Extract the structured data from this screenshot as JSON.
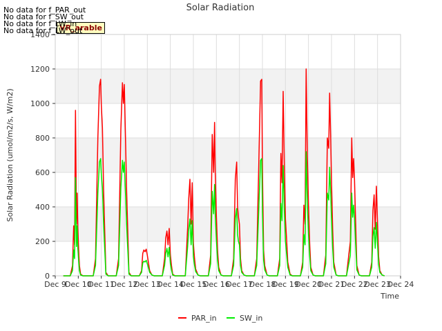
{
  "no_data_messages": [
    "No data for f_PAR_out",
    "No data for f_SW_out",
    "No data for f_LW_in",
    "No data for f_LW_out"
  ],
  "badge_label": "VR_arable",
  "chart_data": {
    "type": "line",
    "title": "Solar Radiation",
    "xlabel": "Time",
    "ylabel": "Solar Radiation (umol/m2/s, W/m2)",
    "ylim": [
      0,
      1400
    ],
    "yticks": [
      0,
      200,
      400,
      600,
      800,
      1000,
      1200,
      1400
    ],
    "xlim": [
      9,
      24
    ],
    "xticks": [
      9,
      10,
      11,
      12,
      13,
      14,
      15,
      16,
      17,
      18,
      19,
      20,
      21,
      22,
      23,
      24
    ],
    "xtick_labels": [
      "Dec 9",
      "Dec 10",
      "Dec 11",
      "Dec 12",
      "Dec 13",
      "Dec 14",
      "Dec 15",
      "Dec 16",
      "Dec 17",
      "Dec 18",
      "Dec 19",
      "Dec 20",
      "Dec 21",
      "Dec 22",
      "Dec 23",
      "Dec 24"
    ],
    "grid": true,
    "legend_position": "bottom-center",
    "series": [
      {
        "name": "PAR_in",
        "color": "#ff0000",
        "x": [
          9.35,
          9.65,
          9.75,
          9.8,
          9.84,
          9.88,
          9.92,
          9.95,
          9.98,
          10.02,
          10.05,
          10.1,
          10.2,
          10.3,
          10.65,
          10.75,
          10.85,
          10.92,
          10.97,
          11.0,
          11.05,
          11.1,
          11.2,
          11.3,
          11.65,
          11.75,
          11.85,
          11.92,
          11.96,
          12.0,
          12.05,
          12.1,
          12.2,
          12.3,
          12.65,
          12.75,
          12.8,
          12.85,
          12.9,
          12.95,
          13.0,
          13.05,
          13.1,
          13.2,
          13.3,
          13.65,
          13.75,
          13.8,
          13.85,
          13.9,
          13.95,
          14.0,
          14.05,
          14.1,
          14.2,
          14.3,
          14.65,
          14.75,
          14.8,
          14.85,
          14.9,
          14.95,
          15.0,
          15.05,
          15.1,
          15.2,
          15.3,
          15.65,
          15.75,
          15.82,
          15.88,
          15.92,
          15.95,
          16.0,
          16.05,
          16.1,
          16.2,
          16.3,
          16.65,
          16.75,
          16.82,
          16.88,
          16.92,
          16.96,
          17.0,
          17.05,
          17.1,
          17.2,
          17.3,
          17.65,
          17.75,
          17.85,
          17.92,
          17.97,
          18.0,
          18.05,
          18.1,
          18.2,
          18.3,
          18.65,
          18.75,
          18.8,
          18.85,
          18.9,
          18.95,
          19.0,
          19.05,
          19.1,
          19.2,
          19.3,
          19.65,
          19.75,
          19.8,
          19.85,
          19.9,
          19.95,
          20.0,
          20.05,
          20.1,
          20.2,
          20.3,
          20.65,
          20.75,
          20.82,
          20.88,
          20.92,
          20.96,
          21.0,
          21.05,
          21.1,
          21.2,
          21.3,
          21.65,
          21.75,
          21.82,
          21.88,
          21.92,
          21.96,
          22.0,
          22.05,
          22.1,
          22.2,
          22.3,
          22.65,
          22.75,
          22.8,
          22.85,
          22.9,
          22.95,
          23.0,
          23.05,
          23.1,
          23.2,
          23.3
        ],
        "y": [
          0,
          0,
          60,
          290,
          180,
          960,
          300,
          480,
          280,
          140,
          60,
          10,
          0,
          0,
          0,
          100,
          800,
          1100,
          1140,
          990,
          860,
          500,
          20,
          0,
          0,
          100,
          850,
          1120,
          1000,
          1110,
          800,
          500,
          20,
          0,
          0,
          30,
          130,
          150,
          140,
          155,
          120,
          75,
          30,
          5,
          0,
          0,
          100,
          220,
          260,
          180,
          275,
          120,
          60,
          10,
          0,
          0,
          0,
          280,
          450,
          560,
          300,
          540,
          190,
          100,
          40,
          5,
          0,
          0,
          120,
          820,
          600,
          890,
          590,
          350,
          150,
          50,
          5,
          0,
          0,
          100,
          560,
          660,
          400,
          340,
          300,
          100,
          30,
          5,
          0,
          0,
          100,
          700,
          1130,
          1140,
          620,
          150,
          60,
          5,
          0,
          0,
          100,
          710,
          540,
          1070,
          640,
          330,
          210,
          80,
          10,
          0,
          0,
          80,
          410,
          300,
          1200,
          700,
          410,
          200,
          50,
          5,
          0,
          0,
          120,
          800,
          740,
          1060,
          820,
          550,
          270,
          80,
          5,
          0,
          0,
          120,
          200,
          800,
          570,
          680,
          560,
          300,
          60,
          5,
          0,
          0,
          80,
          380,
          470,
          270,
          520,
          300,
          110,
          30,
          5,
          0
        ]
      },
      {
        "name": "SW_in",
        "color": "#00ee00",
        "x": [
          9.35,
          9.65,
          9.75,
          9.8,
          9.84,
          9.88,
          9.92,
          9.95,
          9.98,
          10.02,
          10.05,
          10.1,
          10.2,
          10.3,
          10.65,
          10.75,
          10.85,
          10.92,
          10.97,
          11.0,
          11.05,
          11.1,
          11.2,
          11.3,
          11.65,
          11.75,
          11.85,
          11.92,
          11.96,
          12.0,
          12.05,
          12.1,
          12.2,
          12.3,
          12.65,
          12.75,
          12.8,
          12.85,
          12.9,
          12.95,
          13.0,
          13.05,
          13.1,
          13.2,
          13.3,
          13.65,
          13.75,
          13.8,
          13.85,
          13.9,
          13.95,
          14.0,
          14.05,
          14.1,
          14.2,
          14.3,
          14.65,
          14.75,
          14.8,
          14.85,
          14.9,
          14.95,
          15.0,
          15.05,
          15.1,
          15.2,
          15.3,
          15.65,
          15.75,
          15.82,
          15.88,
          15.92,
          15.95,
          16.0,
          16.05,
          16.1,
          16.2,
          16.3,
          16.65,
          16.75,
          16.82,
          16.88,
          16.92,
          16.96,
          17.0,
          17.05,
          17.1,
          17.2,
          17.3,
          17.65,
          17.75,
          17.85,
          17.92,
          17.97,
          18.0,
          18.05,
          18.1,
          18.2,
          18.3,
          18.65,
          18.75,
          18.8,
          18.85,
          18.9,
          18.95,
          19.0,
          19.05,
          19.1,
          19.2,
          19.3,
          19.65,
          19.75,
          19.8,
          19.85,
          19.9,
          19.95,
          20.0,
          20.05,
          20.1,
          20.2,
          20.3,
          20.65,
          20.75,
          20.82,
          20.88,
          20.92,
          20.96,
          21.0,
          21.05,
          21.1,
          21.2,
          21.3,
          21.65,
          21.75,
          21.82,
          21.88,
          21.92,
          21.96,
          22.0,
          22.05,
          22.1,
          22.2,
          22.3,
          22.65,
          22.75,
          22.8,
          22.85,
          22.9,
          22.95,
          23.0,
          23.05,
          23.1,
          23.2,
          23.3
        ],
        "y": [
          0,
          0,
          30,
          150,
          100,
          570,
          170,
          290,
          160,
          80,
          30,
          5,
          0,
          0,
          0,
          60,
          480,
          660,
          680,
          590,
          510,
          300,
          10,
          0,
          0,
          60,
          510,
          670,
          600,
          660,
          480,
          300,
          10,
          0,
          0,
          20,
          75,
          85,
          80,
          90,
          70,
          45,
          20,
          5,
          0,
          0,
          60,
          130,
          160,
          110,
          165,
          70,
          35,
          5,
          0,
          0,
          0,
          170,
          270,
          330,
          180,
          320,
          110,
          60,
          25,
          5,
          0,
          0,
          70,
          490,
          360,
          530,
          350,
          210,
          90,
          30,
          5,
          0,
          0,
          60,
          330,
          390,
          240,
          200,
          180,
          60,
          20,
          5,
          0,
          0,
          60,
          420,
          670,
          680,
          370,
          90,
          35,
          5,
          0,
          0,
          60,
          420,
          320,
          640,
          380,
          200,
          125,
          50,
          5,
          0,
          0,
          50,
          240,
          180,
          720,
          420,
          240,
          120,
          30,
          5,
          0,
          0,
          70,
          480,
          440,
          630,
          490,
          330,
          160,
          50,
          5,
          0,
          0,
          70,
          120,
          480,
          340,
          410,
          340,
          180,
          35,
          5,
          0,
          0,
          50,
          230,
          280,
          160,
          310,
          180,
          65,
          20,
          5,
          0
        ]
      }
    ]
  }
}
